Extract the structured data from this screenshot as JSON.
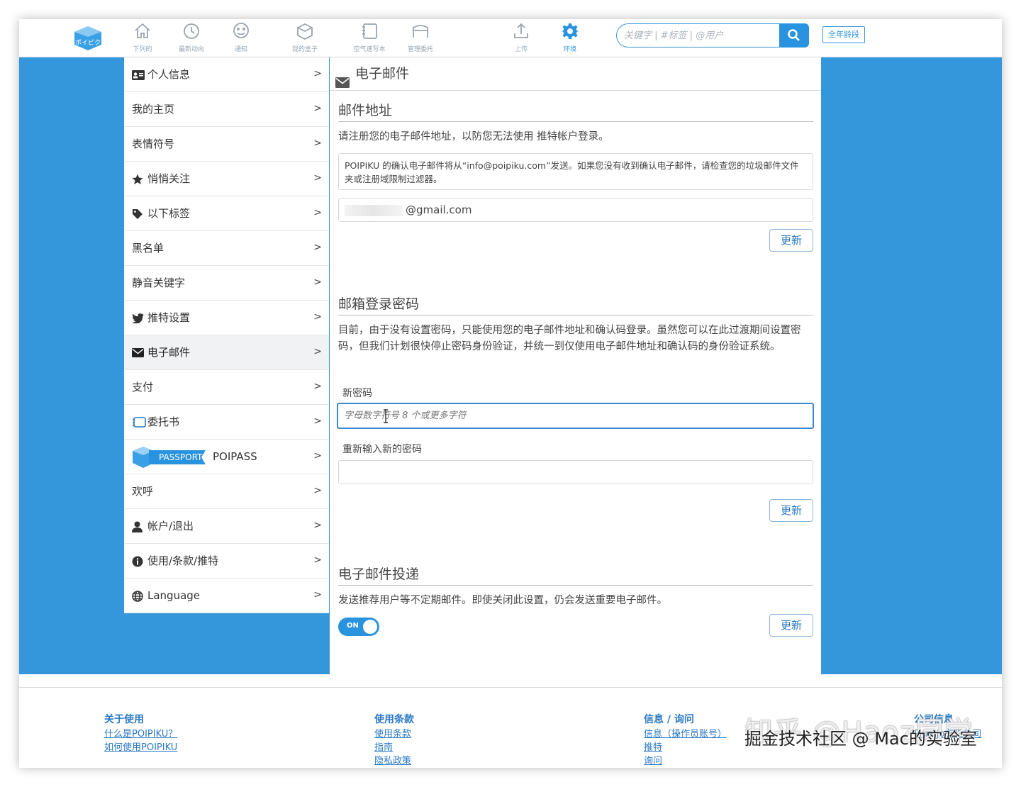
{
  "header": {
    "logo_text": "ポイピク",
    "nav": [
      {
        "label": "下列的",
        "icon": "home-icon"
      },
      {
        "label": "最新动向",
        "icon": "clock-icon"
      },
      {
        "label": "通知",
        "icon": "chat-icon"
      },
      {
        "label": "我的盒子",
        "icon": "box-icon"
      },
      {
        "label": "空气速写本",
        "icon": "sketchbook-icon"
      },
      {
        "label": "管理委托",
        "icon": "commission-icon"
      },
      {
        "label": "上传",
        "icon": "upload-icon"
      },
      {
        "label": "环境",
        "icon": "gear-icon"
      }
    ],
    "search_placeholder": "关键字 | #标签 | @用户",
    "age_filter": "全年龄段"
  },
  "sidebar": {
    "items": [
      {
        "label": "个人信息",
        "icon": "id-card-icon"
      },
      {
        "label": "我的主页",
        "icon": ""
      },
      {
        "label": "表情符号",
        "icon": ""
      },
      {
        "label": "悄悄关注",
        "icon": "star-icon"
      },
      {
        "label": "以下标签",
        "icon": "tag-icon"
      },
      {
        "label": "黑名单",
        "icon": ""
      },
      {
        "label": "静音关键字",
        "icon": ""
      },
      {
        "label": "推特设置",
        "icon": "twitter-icon"
      },
      {
        "label": "电子邮件",
        "icon": "envelope-icon"
      },
      {
        "label": "支付",
        "icon": ""
      },
      {
        "label": "委托书",
        "icon": "commission-icon"
      },
      {
        "label": "POIPASS",
        "icon": "passport-icon",
        "badge": "PASSPORT"
      },
      {
        "label": "欢呼",
        "icon": ""
      },
      {
        "label": "帐户/退出",
        "icon": "user-icon"
      },
      {
        "label": "使用/条款/推特",
        "icon": "info-icon"
      },
      {
        "label": "Language",
        "icon": "globe-icon"
      }
    ],
    "active_index": 8,
    "chevron": ">"
  },
  "content": {
    "title": "电子邮件",
    "email_section": {
      "heading": "邮件地址",
      "description": "请注册您的电子邮件地址，以防您无法使用 推特帐户登录。",
      "notice": "POIPIKU 的确认电子邮件将从“info@poipiku.com”发送。如果您没有收到确认电子邮件，请检查您的垃圾邮件文件夹或注册域限制过滤器。",
      "email_value": "@gmail.com",
      "update_label": "更新"
    },
    "password_section": {
      "heading": "邮箱登录密码",
      "description": "目前，由于没有设置密码，只能使用您的电子邮件地址和确认码登录。虽然您可以在此过渡期间设置密码，但我们计划很快停止密码身份验证，并统一到仅使用电子邮件地址和确认码的身份验证系统。",
      "new_password_label": "新密码",
      "new_password_placeholder": "字母数字符号 8 个或更多字符",
      "confirm_label": "重新输入新的密码",
      "update_label": "更新"
    },
    "delivery_section": {
      "heading": "电子邮件投递",
      "description": "发送推荐用户等不定期邮件。即使关闭此设置，仍会发送重要电子邮件。",
      "toggle_label": "ON",
      "toggle_on": true,
      "update_label": "更新"
    }
  },
  "footer": {
    "columns": [
      {
        "heading": "关于使用",
        "links": [
          "什么是POIPIKU？",
          "如何使用POIPIKU"
        ]
      },
      {
        "heading": "使用条款",
        "links": [
          "使用条款",
          "指南",
          "隐私政策"
        ]
      },
      {
        "heading": "信息 / 询问",
        "links": [
          "信息（操作员账号）",
          "推特",
          "询问"
        ]
      },
      {
        "heading": "公司信息",
        "links": [
          "Pipa.jp有限公司"
        ]
      }
    ]
  },
  "watermark": {
    "line1": "知乎 @Haoz同学",
    "line2": "掘金技术社区 @ Mac的实验室"
  },
  "colors": {
    "accent": "#2a93e0",
    "band": "#3497db",
    "link": "#2a78c4"
  }
}
